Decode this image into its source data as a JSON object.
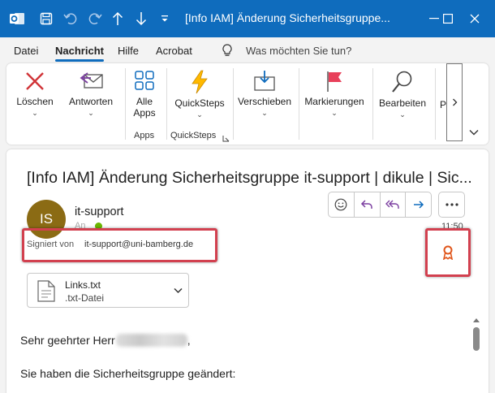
{
  "window": {
    "title": "[Info IAM] Änderung Sicherheitsgruppe..."
  },
  "menu": {
    "items": [
      "Datei",
      "Nachricht",
      "Hilfe",
      "Acrobat"
    ],
    "active": "Nachricht",
    "search_placeholder": "Was möchten Sie tun?"
  },
  "ribbon": {
    "loeschen": "Löschen",
    "antworten": "Antworten",
    "alle_apps": [
      "Alle",
      "Apps"
    ],
    "quicksteps": "QuickSteps",
    "verschieben": "Verschieben",
    "markierungen": "Markierungen",
    "bearbeiten": "Bearbeiten",
    "more_truncated": "P",
    "group_apps": "Apps",
    "group_quicksteps": "QuickSteps"
  },
  "message": {
    "subject": "[Info IAM] Änderung Sicherheitsgruppe it-support | dikule | Sic...",
    "avatar_initials": "IS",
    "sender": "it-support",
    "to_label": "An",
    "time": "11:50",
    "signed_label": "Signiert von",
    "signed_email": "it-support@uni-bamberg.de",
    "attachment": {
      "name": "Links.txt",
      "type": ".txt-Datei"
    },
    "body": {
      "greeting_prefix": "Sehr geehrter Herr",
      "greeting_suffix": ",",
      "line2": "Sie haben die Sicherheitsgruppe geändert:"
    }
  },
  "colors": {
    "brand_blue": "#0f6cbd",
    "highlight_red": "#d2404f",
    "reply_purple": "#7b3fa0",
    "avatar_bg": "#8b6b14",
    "presence_green": "#6bb700"
  }
}
